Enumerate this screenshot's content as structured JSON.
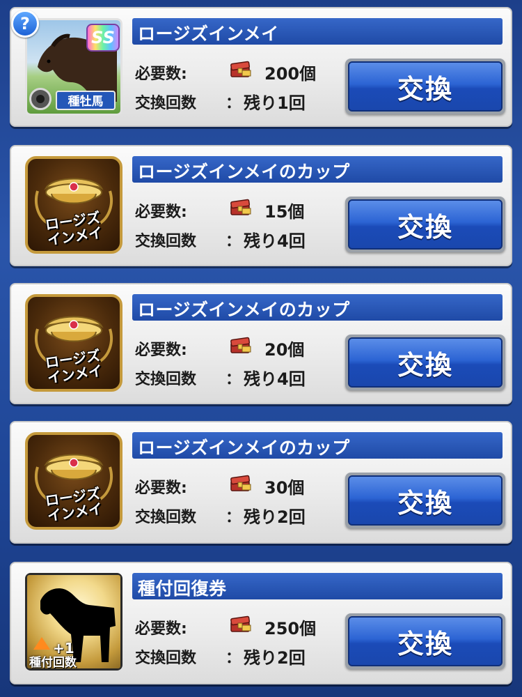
{
  "labels": {
    "required": "必要数:",
    "exchange_count": "交換回数",
    "colon": "："
  },
  "items": [
    {
      "title": "ロージズインメイ",
      "required_count": "200個",
      "remaining": "残り1回",
      "button_label": "交換",
      "thumb": {
        "type": "horse",
        "rarity": "SS",
        "tag": "種牡馬"
      }
    },
    {
      "title": "ロージズインメイのカップ",
      "required_count": "15個",
      "remaining": "残り4回",
      "button_label": "交換",
      "thumb": {
        "type": "cup",
        "caption_1": "ロージズ",
        "caption_2": "インメイ"
      }
    },
    {
      "title": "ロージズインメイのカップ",
      "required_count": "20個",
      "remaining": "残り4回",
      "button_label": "交換",
      "thumb": {
        "type": "cup",
        "caption_1": "ロージズ",
        "caption_2": "インメイ"
      }
    },
    {
      "title": "ロージズインメイのカップ",
      "required_count": "30個",
      "remaining": "残り2回",
      "button_label": "交換",
      "thumb": {
        "type": "cup",
        "caption_1": "ロージズ",
        "caption_2": "インメイ"
      }
    },
    {
      "title": "種付回復券",
      "required_count": "250個",
      "remaining": "残り2回",
      "button_label": "交換",
      "thumb": {
        "type": "ticket",
        "plus": "+1",
        "caption": "種付回数"
      }
    }
  ],
  "help_icon": "?",
  "colors": {
    "background": "#1f469a",
    "title_bar": "#2653b3",
    "button": "#2c64d4"
  }
}
